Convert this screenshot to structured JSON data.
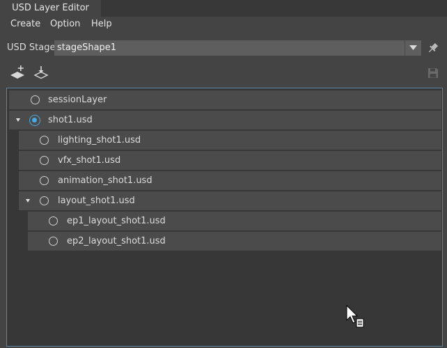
{
  "tab": {
    "title": "USD Layer Editor"
  },
  "menu": {
    "items": [
      "Create",
      "Option",
      "Help"
    ]
  },
  "stage": {
    "label": "USD Stage:",
    "value": "stageShape1"
  },
  "layers": [
    {
      "name": "sessionLayer"
    },
    {
      "name": "shot1.usd",
      "expanded": true,
      "target": true
    },
    {
      "name": "lighting_shot1.usd"
    },
    {
      "name": "vfx_shot1.usd"
    },
    {
      "name": "animation_shot1.usd"
    },
    {
      "name": "layout_shot1.usd",
      "expanded": true
    },
    {
      "name": "ep1_layout_shot1.usd"
    },
    {
      "name": "ep2_layout_shot1.usd"
    }
  ],
  "colors": {
    "target_layer": "#4aa7e0",
    "tree_border": "#5a86a8"
  },
  "icons": {
    "add_layer": "add-layer-icon",
    "load_layer": "load-layer-icon",
    "pin": "pin-icon",
    "save": "save-icon"
  }
}
